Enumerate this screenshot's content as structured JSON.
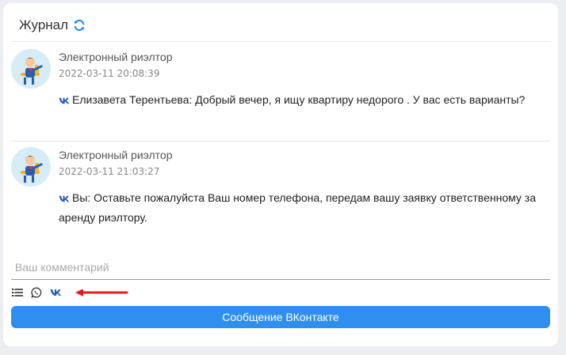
{
  "journal": {
    "title": "Журнал",
    "refresh_icon": "refresh-icon",
    "accent_color": "#2f8ff0"
  },
  "entries": [
    {
      "author": "Электронный риэлтор",
      "timestamp": "2022-03-11 20:08:39",
      "channel_icon": "vk-icon",
      "message": "Елизавета Терентьева: Добрый вечер, я ищу квартиру недорого . У вас есть варианты?"
    },
    {
      "author": "Электронный риэлтор",
      "timestamp": "2022-03-11 21:03:27",
      "channel_icon": "vk-icon",
      "message": "Вы: Оставьте пожалуйста Ваш номер телефона, передам вашу заявку ответственному за аренду риэлтору."
    }
  ],
  "composer": {
    "placeholder": "Ваш комментарий",
    "tools": [
      "list-icon",
      "whatsapp-icon",
      "vk-icon"
    ],
    "send_label": "Сообщение ВКонтакте",
    "annotation": "red-arrow-icon"
  }
}
